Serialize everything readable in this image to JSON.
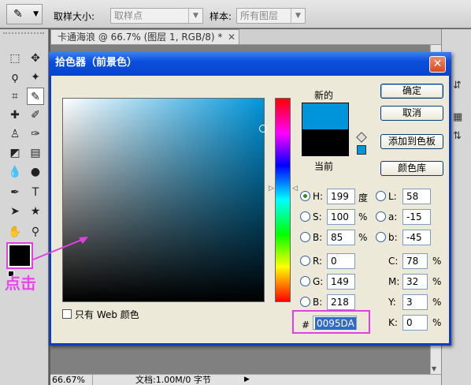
{
  "options_bar": {
    "sample_size_label": "取样大小:",
    "sample_size_value": "取样点",
    "sample_label": "样本:",
    "sample_value": "所有图层"
  },
  "document": {
    "tab_title": "卡通海浪 @ 66.7% (图层 1, RGB/8) *",
    "zoom": "66.67%",
    "doc_info": "文档:1.00M/0 字节"
  },
  "annotation": {
    "click_label": "点击"
  },
  "dialog": {
    "title": "拾色器（前景色）",
    "new_label": "新的",
    "current_label": "当前",
    "web_only_label": "只有 Web 颜色",
    "buttons": {
      "ok": "确定",
      "cancel": "取消",
      "add_to_swatches": "添加到色板",
      "color_libraries": "颜色库"
    },
    "hsb": {
      "h": {
        "label": "H:",
        "value": "199",
        "unit": "度"
      },
      "s": {
        "label": "S:",
        "value": "100",
        "unit": "%"
      },
      "b": {
        "label": "B:",
        "value": "85",
        "unit": "%"
      }
    },
    "rgb": {
      "r": {
        "label": "R:",
        "value": "0"
      },
      "g": {
        "label": "G:",
        "value": "149"
      },
      "b": {
        "label": "B:",
        "value": "218"
      }
    },
    "lab": {
      "l": {
        "label": "L:",
        "value": "58"
      },
      "a": {
        "label": "a:",
        "value": "-15"
      },
      "b": {
        "label": "b:",
        "value": "-45"
      }
    },
    "cmyk": {
      "c": {
        "label": "C:",
        "value": "78",
        "unit": "%"
      },
      "m": {
        "label": "M:",
        "value": "32",
        "unit": "%"
      },
      "y": {
        "label": "Y:",
        "value": "3",
        "unit": "%"
      },
      "k": {
        "label": "K:",
        "value": "0",
        "unit": "%"
      }
    },
    "hex_label": "#",
    "hex_value": "0095DA",
    "colors": {
      "new_color": "#0095da",
      "current_color": "#000000"
    }
  }
}
